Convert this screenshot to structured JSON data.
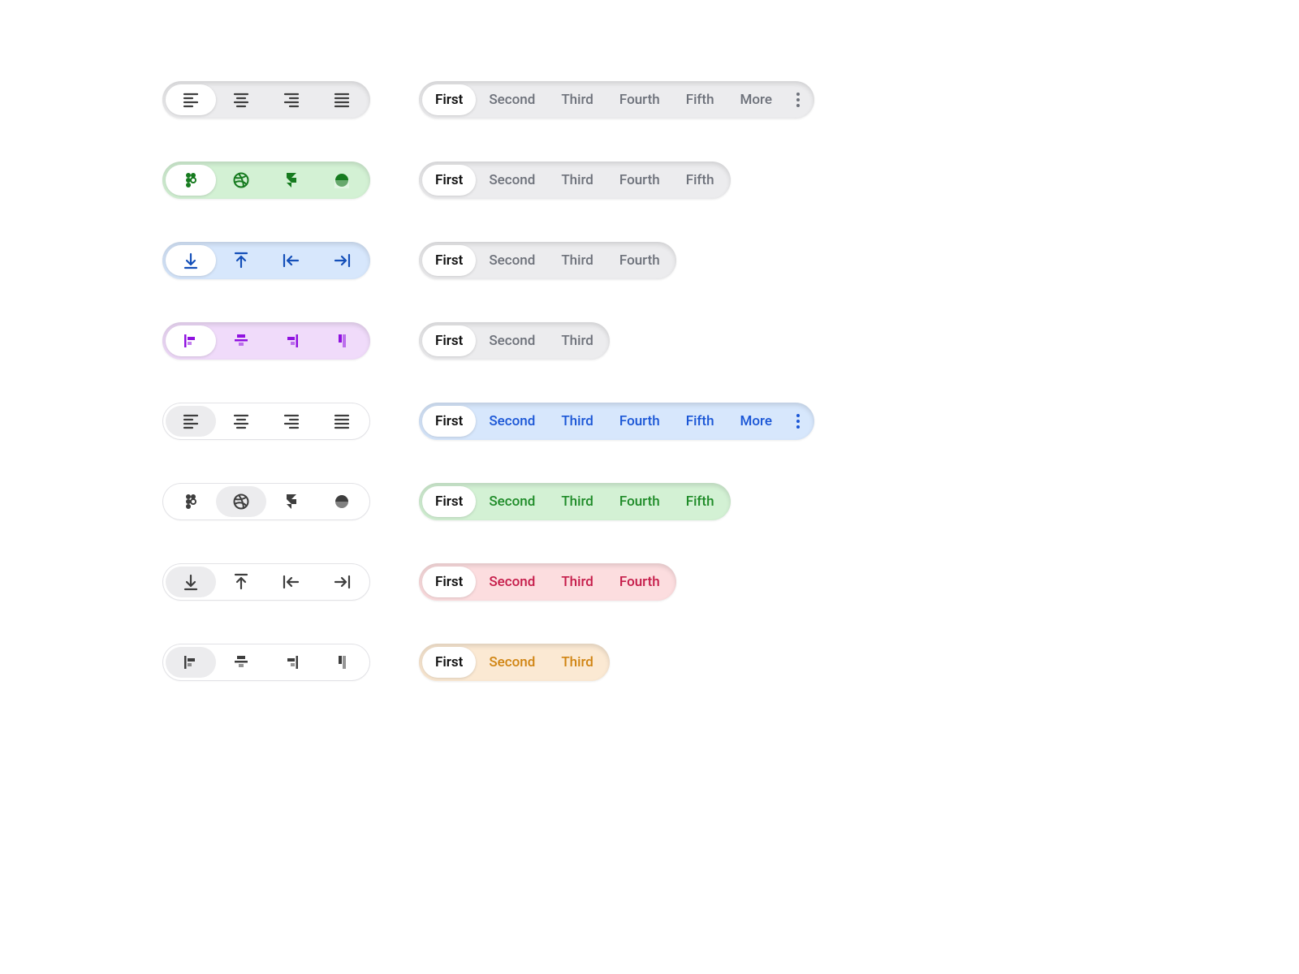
{
  "labels": {
    "first": "First",
    "second": "Second",
    "third": "Third",
    "fourth": "Fourth",
    "fifth": "Fifth",
    "more": "More"
  },
  "rows": [
    {
      "ipill": {
        "theme": "gray",
        "sel": 0,
        "icons": [
          "align-left",
          "align-center",
          "align-right",
          "align-justify"
        ]
      },
      "tpill": {
        "theme": "gray",
        "sel": 0,
        "items": [
          "first",
          "second",
          "third",
          "fourth",
          "fifth",
          "more"
        ],
        "more": true
      }
    },
    {
      "ipill": {
        "theme": "green",
        "sel": 0,
        "icons": [
          "figma",
          "dribbble",
          "framer",
          "horizon"
        ]
      },
      "tpill": {
        "theme": "gray",
        "sel": 0,
        "items": [
          "first",
          "second",
          "third",
          "fourth",
          "fifth"
        ],
        "more": false
      }
    },
    {
      "ipill": {
        "theme": "blue",
        "sel": 0,
        "icons": [
          "arrow-down-bar",
          "arrow-up-bar",
          "arrow-left-bar",
          "arrow-right-bar"
        ]
      },
      "tpill": {
        "theme": "gray",
        "sel": 0,
        "items": [
          "first",
          "second",
          "third",
          "fourth"
        ],
        "more": false
      }
    },
    {
      "ipill": {
        "theme": "purple",
        "sel": 0,
        "icons": [
          "valign-left",
          "valign-center",
          "valign-right",
          "valign-stretch"
        ]
      },
      "tpill": {
        "theme": "gray",
        "sel": 0,
        "items": [
          "first",
          "second",
          "third"
        ],
        "more": false
      }
    },
    {
      "ipill": {
        "theme": "out",
        "sel": 0,
        "icons": [
          "align-left",
          "align-center",
          "align-right",
          "align-justify"
        ]
      },
      "tpill": {
        "theme": "blue",
        "sel": 0,
        "items": [
          "first",
          "second",
          "third",
          "fourth",
          "fifth",
          "more"
        ],
        "more": true
      }
    },
    {
      "ipill": {
        "theme": "out",
        "sel": 1,
        "icons": [
          "figma",
          "dribbble",
          "framer",
          "horizon"
        ]
      },
      "tpill": {
        "theme": "green",
        "sel": 0,
        "items": [
          "first",
          "second",
          "third",
          "fourth",
          "fifth"
        ],
        "more": false
      }
    },
    {
      "ipill": {
        "theme": "out",
        "sel": 0,
        "icons": [
          "arrow-down-bar",
          "arrow-up-bar",
          "arrow-left-bar",
          "arrow-right-bar"
        ]
      },
      "tpill": {
        "theme": "red",
        "sel": 0,
        "items": [
          "first",
          "second",
          "third",
          "fourth"
        ],
        "more": false
      }
    },
    {
      "ipill": {
        "theme": "out",
        "sel": 0,
        "icons": [
          "valign-left",
          "valign-center",
          "valign-right",
          "valign-stretch"
        ]
      },
      "tpill": {
        "theme": "orange",
        "sel": 0,
        "items": [
          "first",
          "second",
          "third"
        ],
        "more": false
      }
    }
  ],
  "colors": {
    "gray": "#ECECEE",
    "green": "#D3F1D4",
    "blue": "#D7E7FC",
    "purple": "#F0DBFA",
    "red": "#FCDDDF",
    "orange": "#FBE9D3"
  },
  "iconColors": {
    "gray": "#3e3e3e",
    "green": "#167b1f",
    "blue": "#144fb9",
    "purple": "#9012e0",
    "out": "#3e3e3e"
  }
}
